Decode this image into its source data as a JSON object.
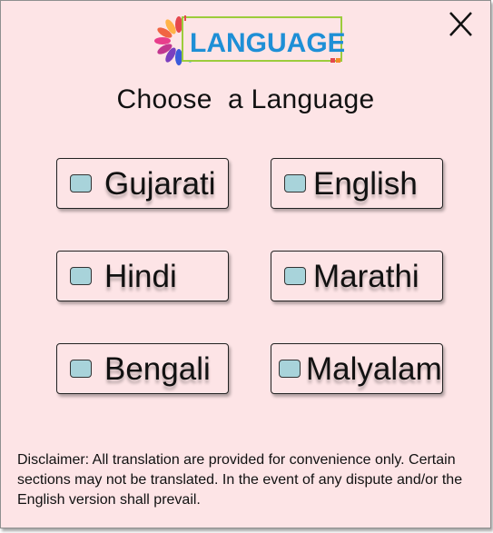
{
  "logo": {
    "text": "LANGUAGE"
  },
  "dialog": {
    "title": "Choose  a Language"
  },
  "languages": [
    {
      "label": "Gujarati"
    },
    {
      "label": "English"
    },
    {
      "label": "Hindi"
    },
    {
      "label": "Marathi"
    },
    {
      "label": "Bengali"
    },
    {
      "label": "Malyalam"
    }
  ],
  "disclaimer": {
    "text": "Disclaimer: All translation are provided for convenience only. Certain sections may not be translated. In the event of any dispute and/or the English version shall prevail."
  },
  "colors": {
    "background": "#fde4e6",
    "checkbox": "#a8d3da",
    "logo_text": "#1e8fd6"
  },
  "icons": {
    "close": "close-icon",
    "logo": "mandala-logo-icon"
  }
}
